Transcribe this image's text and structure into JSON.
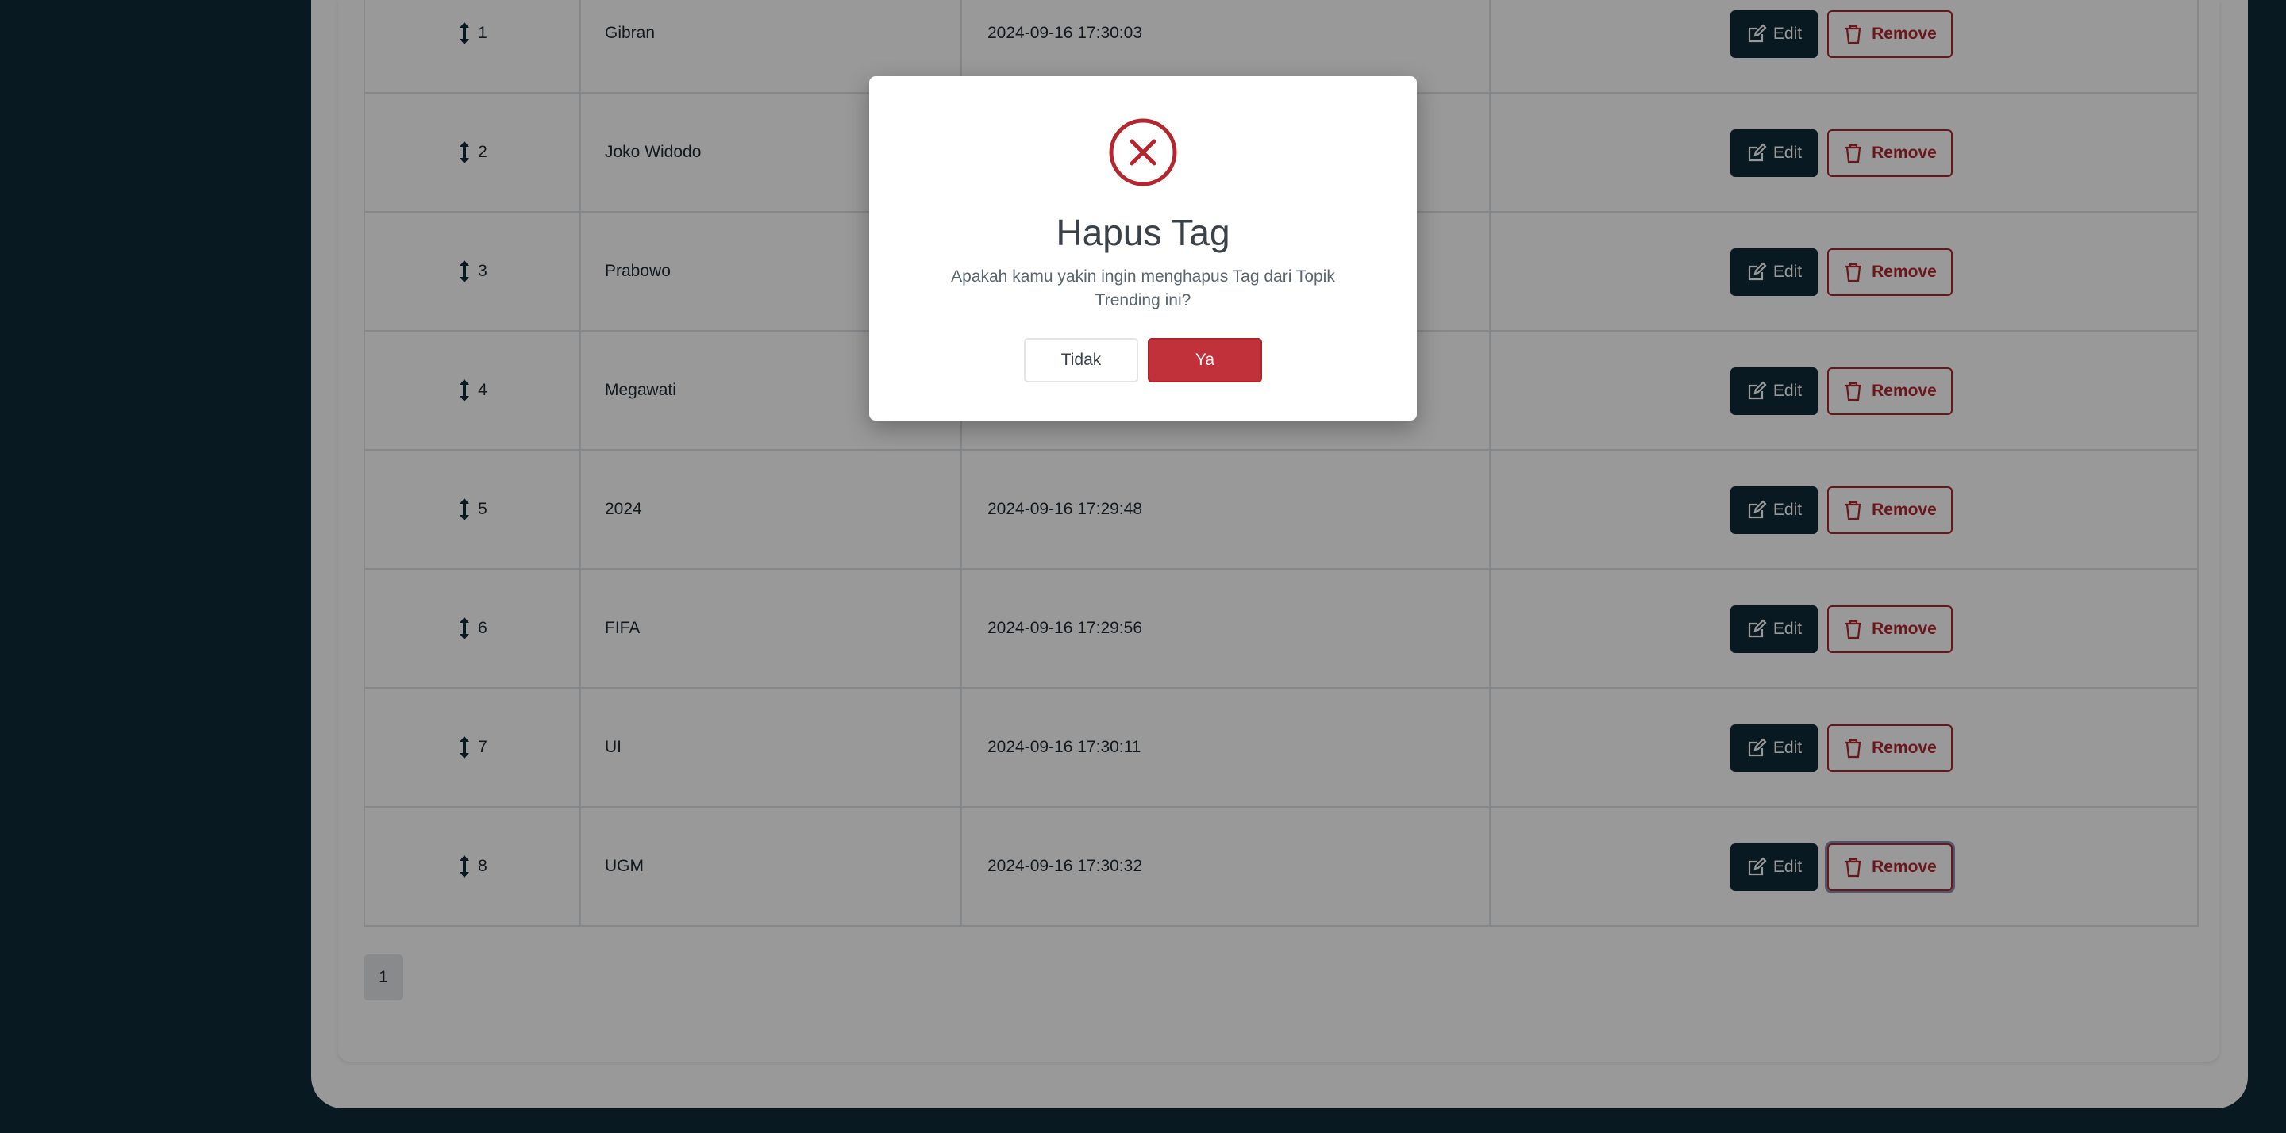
{
  "table": {
    "rows": [
      {
        "order": "1",
        "name": "Gibran",
        "date": "2024-09-16 17:30:03"
      },
      {
        "order": "2",
        "name": "Joko Widodo",
        "date": ""
      },
      {
        "order": "3",
        "name": "Prabowo",
        "date": ""
      },
      {
        "order": "4",
        "name": "Megawati",
        "date": ""
      },
      {
        "order": "5",
        "name": "2024",
        "date": "2024-09-16 17:29:48"
      },
      {
        "order": "6",
        "name": "FIFA",
        "date": "2024-09-16 17:29:56"
      },
      {
        "order": "7",
        "name": "UI",
        "date": "2024-09-16 17:30:11"
      },
      {
        "order": "8",
        "name": "UGM",
        "date": "2024-09-16 17:30:32"
      }
    ],
    "edit_label": "Edit",
    "remove_label": "Remove"
  },
  "pagination": {
    "current_page": "1"
  },
  "modal": {
    "title": "Hapus Tag",
    "message": "Apakah kamu yakin ingin menghapus Tag dari Topik Trending ini?",
    "cancel_label": "Tidak",
    "confirm_label": "Ya",
    "icon": "error-circle-icon"
  },
  "colors": {
    "background": "#0e2a38",
    "primary": "#0e2a38",
    "danger": "#b3262d",
    "confirm": "#c0313a"
  }
}
